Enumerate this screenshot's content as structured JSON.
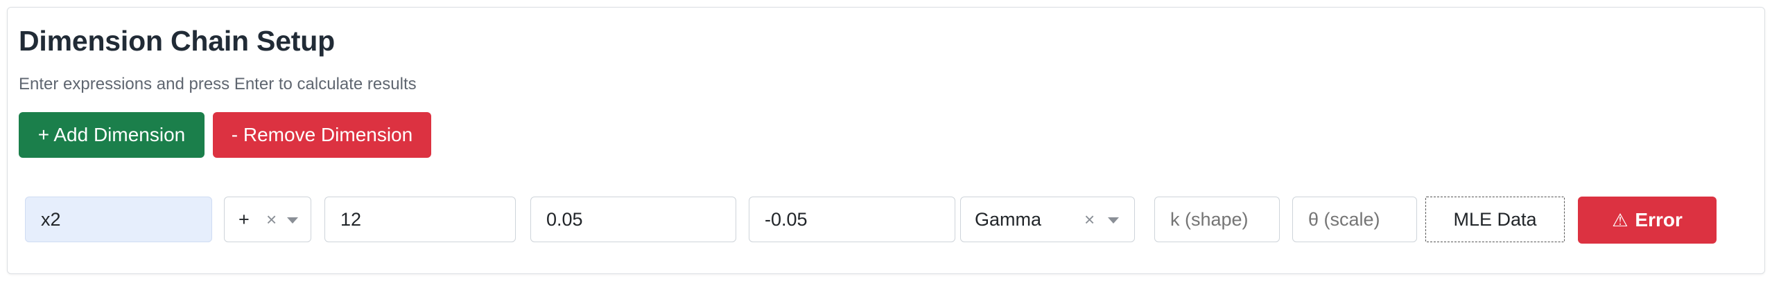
{
  "header": {
    "title": "Dimension Chain Setup",
    "subtitle": "Enter expressions and press Enter to calculate results"
  },
  "actions": {
    "add_label": "+ Add Dimension",
    "remove_label": "- Remove Dimension"
  },
  "dimension_row": {
    "name_value": "x2",
    "operator_value": "+",
    "nominal_value": "12",
    "upper_tol_value": "0.05",
    "lower_tol_value": "-0.05",
    "distribution_value": "Gamma",
    "shape_placeholder": "k (shape)",
    "scale_placeholder": "θ (scale)",
    "mle_label": "MLE Data",
    "error_label": "Error",
    "error_icon": "⚠",
    "clear_glyph": "×"
  },
  "colors": {
    "add": "#1b7f4b",
    "remove": "#dc3241",
    "error": "#dc3241",
    "name_bg": "#e6eefc"
  }
}
